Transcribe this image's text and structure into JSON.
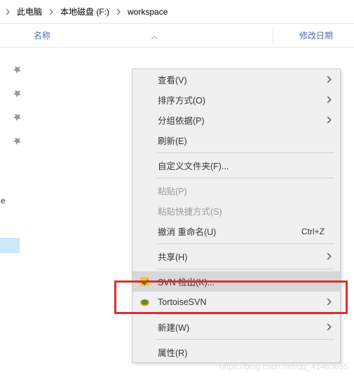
{
  "breadcrumb": {
    "items": [
      "此电脑",
      "本地磁盘 (F:)",
      "workspace"
    ]
  },
  "columns": {
    "name": "名称",
    "sort_indicator": "︿",
    "date": "修改日期"
  },
  "menu": {
    "view": "查看(V)",
    "sort": "排序方式(O)",
    "group": "分组依据(P)",
    "refresh": "刷新(E)",
    "customize": "自定义文件夹(F)...",
    "paste": "粘贴(P)",
    "paste_shortcut": "粘贴快捷方式(S)",
    "undo": "撤消 重命名(U)",
    "undo_shortcut": "Ctrl+Z",
    "share": "共享(H)",
    "svn_checkout": "SVN 检出(K)...",
    "tortoise": "TortoiseSVN",
    "new": "新建(W)",
    "properties": "属性(R)"
  },
  "partial": {
    "file_e": "e"
  },
  "watermark": "https://blog.csdn.net/qq_41463655"
}
